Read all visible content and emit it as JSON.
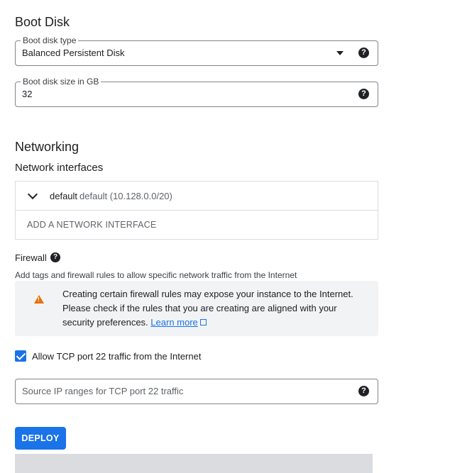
{
  "boot_disk": {
    "heading": "Boot Disk",
    "type_field": {
      "label": "Boot disk type",
      "value": "Balanced Persistent Disk"
    },
    "size_field": {
      "label": "Boot disk size in GB",
      "value": "32"
    }
  },
  "networking": {
    "heading": "Networking",
    "subheading": "Network interfaces",
    "interface": {
      "name": "default",
      "detail": "default (10.128.0.0/20)"
    },
    "add_interface_label": "ADD A NETWORK INTERFACE"
  },
  "firewall": {
    "title": "Firewall",
    "description": "Add tags and firewall rules to allow specific network traffic from the Internet",
    "warning": {
      "text": "Creating certain firewall rules may expose your instance to the Internet. Please check if the rules that you are creating are aligned with your security preferences.",
      "link": "Learn more"
    },
    "allow_tcp22": {
      "label": "Allow TCP port 22 traffic from the Internet",
      "checked": true
    },
    "source_ip": {
      "placeholder": "Source IP ranges for TCP port 22 traffic"
    }
  },
  "actions": {
    "deploy_label": "DEPLOY"
  },
  "icons": {
    "help": "?",
    "warning": "!"
  },
  "colors": {
    "primary": "#1a73e8",
    "warning": "#e8710a"
  }
}
